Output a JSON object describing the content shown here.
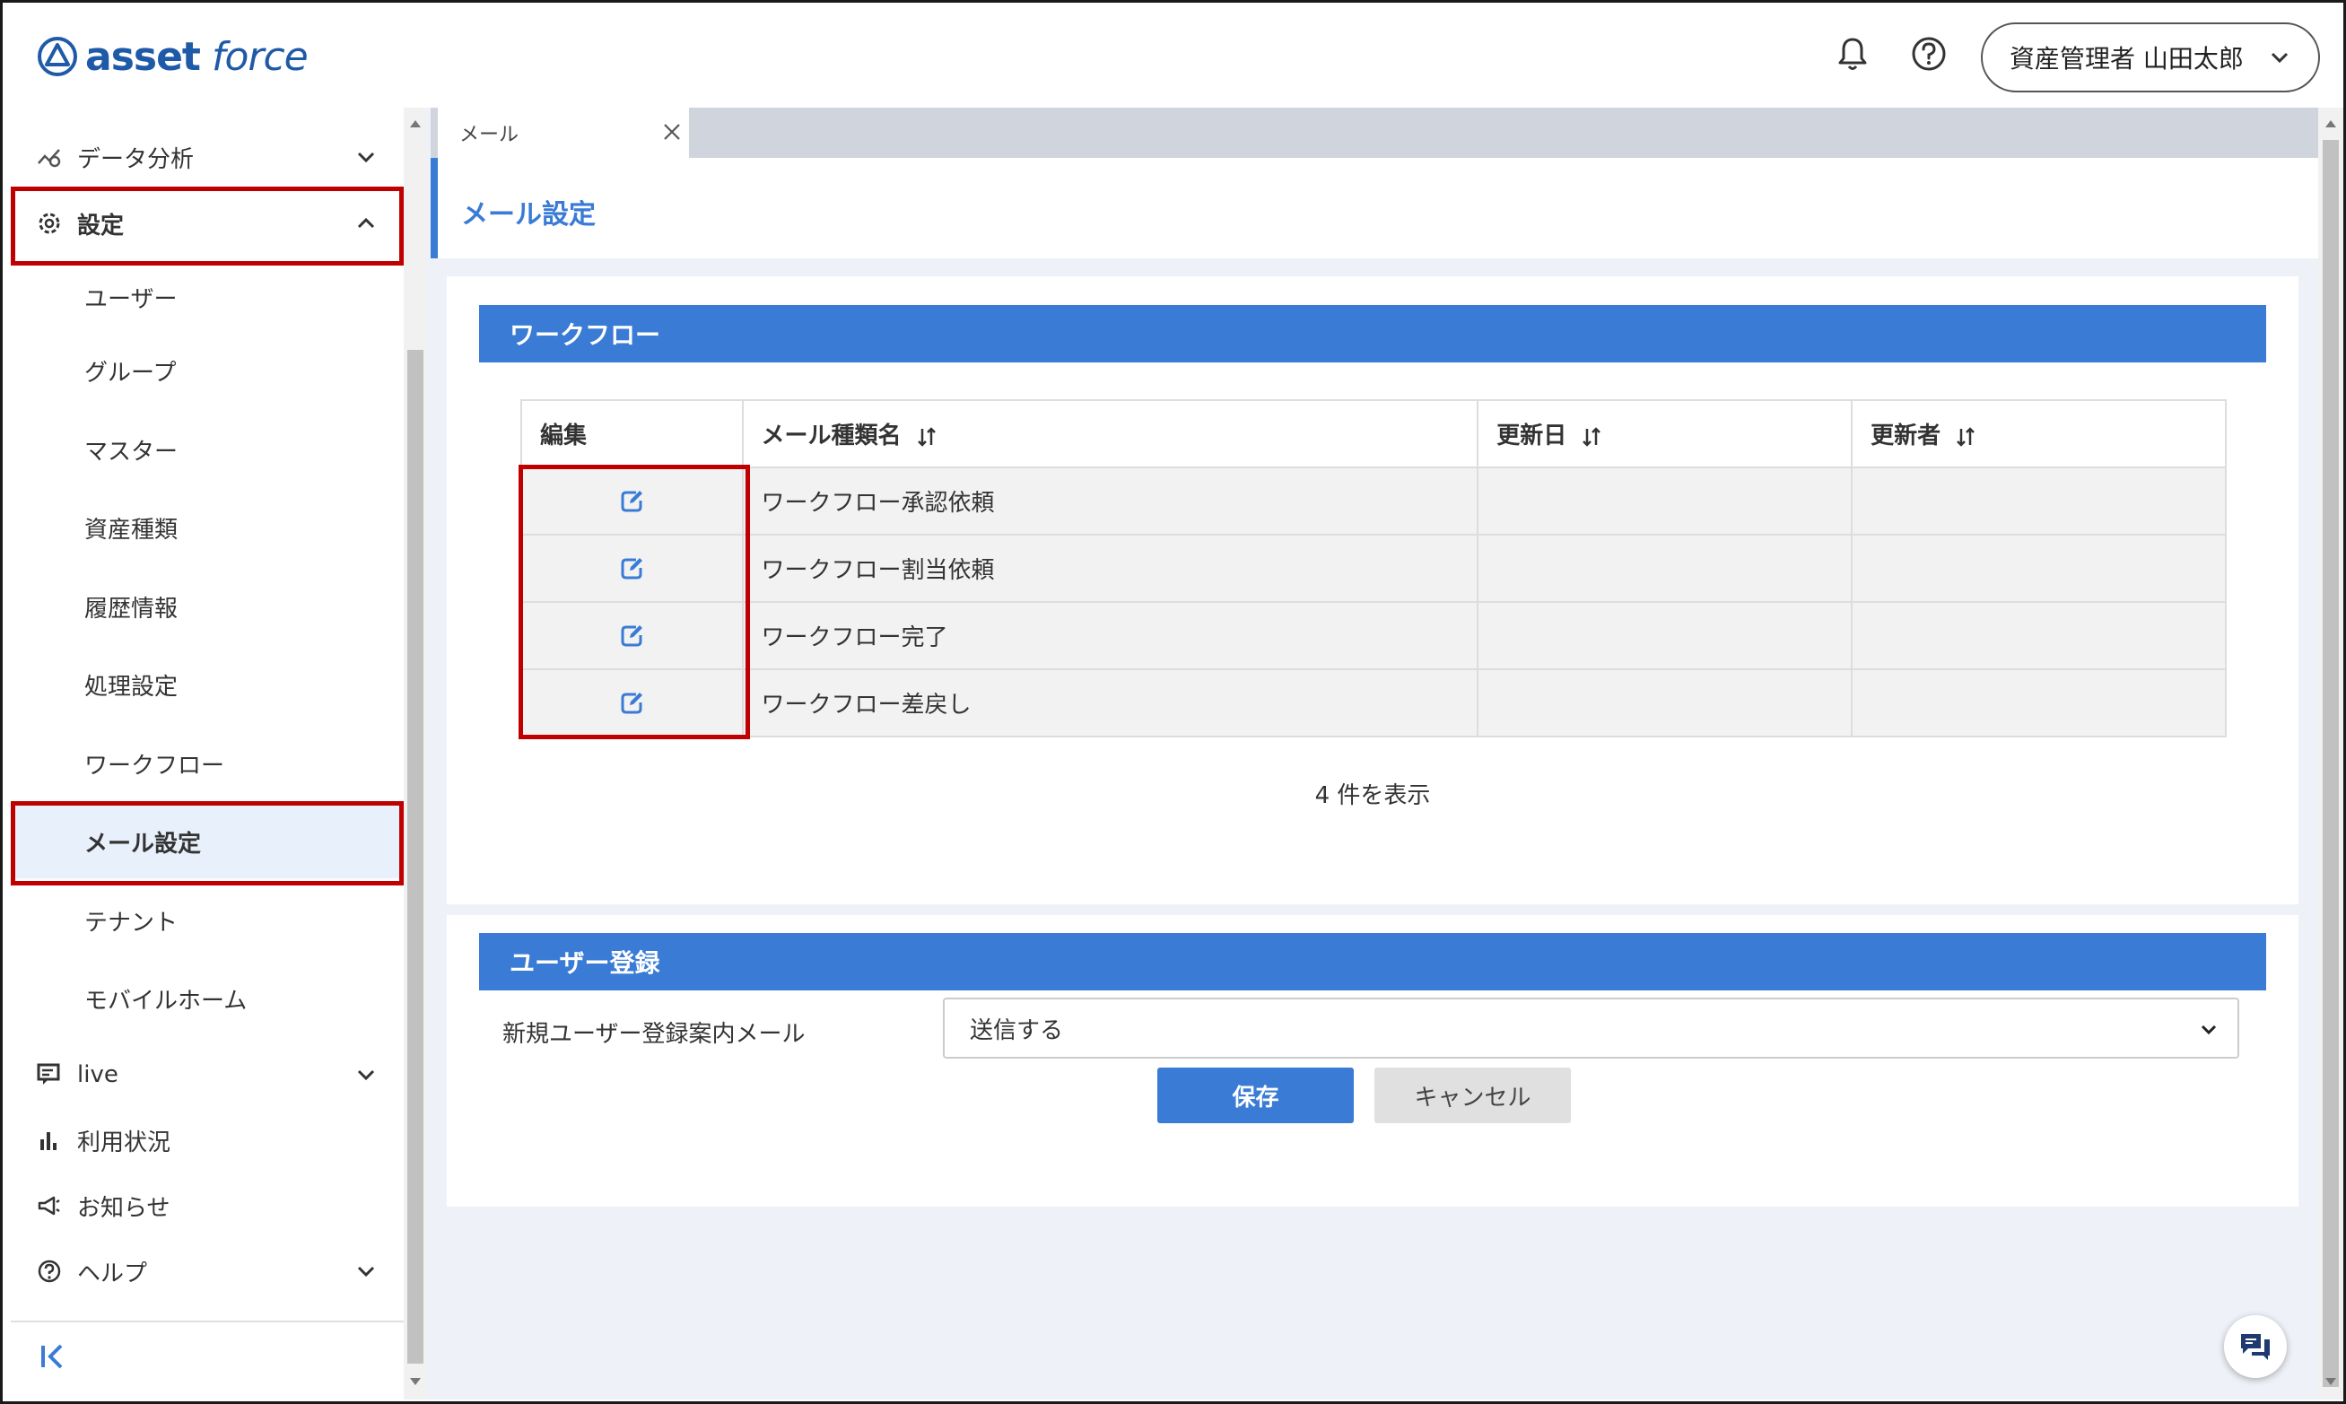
{
  "header": {
    "logo_asset": "asset",
    "logo_force": "force",
    "user_label": "資産管理者 山田太郎",
    "icons": [
      "bell-icon",
      "help-icon",
      "chevron-down-icon"
    ]
  },
  "sidebar": {
    "data_analysis": "データ分析",
    "settings": "設定",
    "sub_items": [
      "ユーザー",
      "グループ",
      "マスター",
      "資産種類",
      "履歴情報",
      "処理設定",
      "ワークフロー",
      "メール設定",
      "テナント",
      "モバイルホーム"
    ],
    "live": "live",
    "usage": "利用状況",
    "notice": "お知らせ",
    "help": "ヘルプ"
  },
  "tabs": {
    "mail": "メール"
  },
  "page": {
    "title": "メール設定"
  },
  "workflow": {
    "heading": "ワークフロー",
    "columns": {
      "edit": "編集",
      "name": "メール種類名",
      "updated": "更新日",
      "updater": "更新者"
    },
    "rows": [
      {
        "name": "ワークフロー承認依頼",
        "updated": "",
        "updater": ""
      },
      {
        "name": "ワークフロー割当依頼",
        "updated": "",
        "updater": ""
      },
      {
        "name": "ワークフロー完了",
        "updated": "",
        "updater": ""
      },
      {
        "name": "ワークフロー差戻し",
        "updated": "",
        "updater": ""
      }
    ],
    "count_text": "4 件を表示"
  },
  "user_registration": {
    "heading": "ユーザー登録",
    "label": "新規ユーザー登録案内メール",
    "selected": "送信する",
    "save": "保存",
    "cancel": "キャンセル"
  },
  "colors": {
    "accent": "#3a7bd5",
    "brand": "#1f5aa8",
    "highlight": "#c00000"
  }
}
